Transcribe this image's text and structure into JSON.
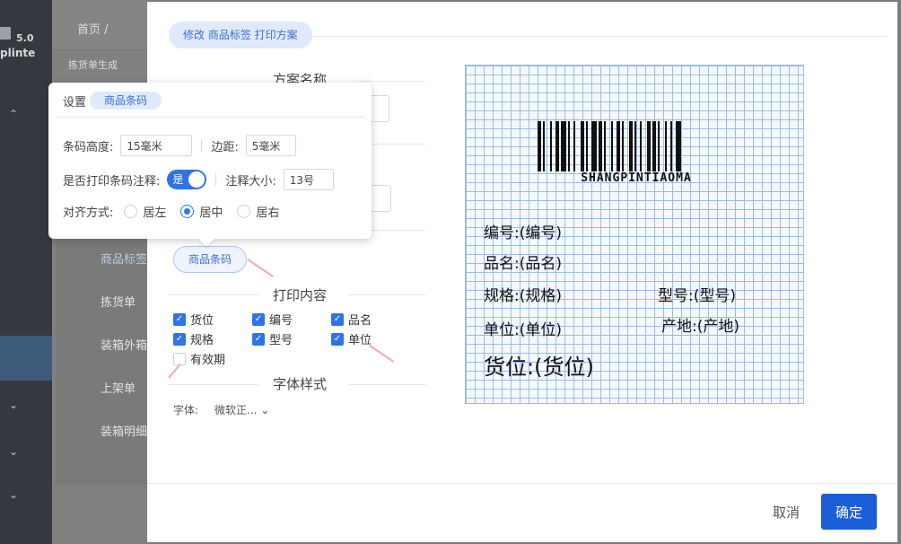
{
  "background": {
    "logo_version": "5.0",
    "logo_name": "plinte",
    "breadcrumb_home": "首页 /",
    "subtab": "拣货单生成",
    "submenu": [
      "商品标签",
      "拣货单",
      "装箱外箱",
      "上架单",
      "装箱明细"
    ]
  },
  "dialog": {
    "title": "修改 商品标签 打印方案",
    "section_scheme": "方案名称",
    "barcode_chip": "商品条码",
    "section_content": "打印内容",
    "checkboxes": [
      {
        "label": "货位",
        "checked": true
      },
      {
        "label": "编号",
        "checked": true
      },
      {
        "label": "品名",
        "checked": true
      },
      {
        "label": "规格",
        "checked": true
      },
      {
        "label": "型号",
        "checked": true
      },
      {
        "label": "单位",
        "checked": true
      },
      {
        "label": "有效期",
        "checked": false
      }
    ],
    "section_font": "字体样式",
    "font_label": "字体:",
    "font_value": "微软正...",
    "font_chevron": "⌄",
    "cancel": "取消",
    "ok": "确定"
  },
  "preview": {
    "barcode_text": "SHANGPINTIAOMA",
    "lines": {
      "code": "编号:(编号)",
      "name": "品名:(品名)",
      "spec": "规格:(规格)",
      "model": "型号:(型号)",
      "unit": "单位:(单位)",
      "origin": "产地:(产地)",
      "location": "货位:(货位)"
    }
  },
  "popover": {
    "title": "设置",
    "chip": "商品条码",
    "height_label": "条码高度:",
    "height_value": "15毫米",
    "margin_label": "边距:",
    "margin_value": "5毫米",
    "annot_label": "是否打印条码注释:",
    "annot_toggle": "是",
    "annot_size_label": "注释大小:",
    "annot_size_value": "13号",
    "align_label": "对齐方式:",
    "align_options": [
      "居左",
      "居中",
      "居右"
    ],
    "align_selected": "居中"
  }
}
